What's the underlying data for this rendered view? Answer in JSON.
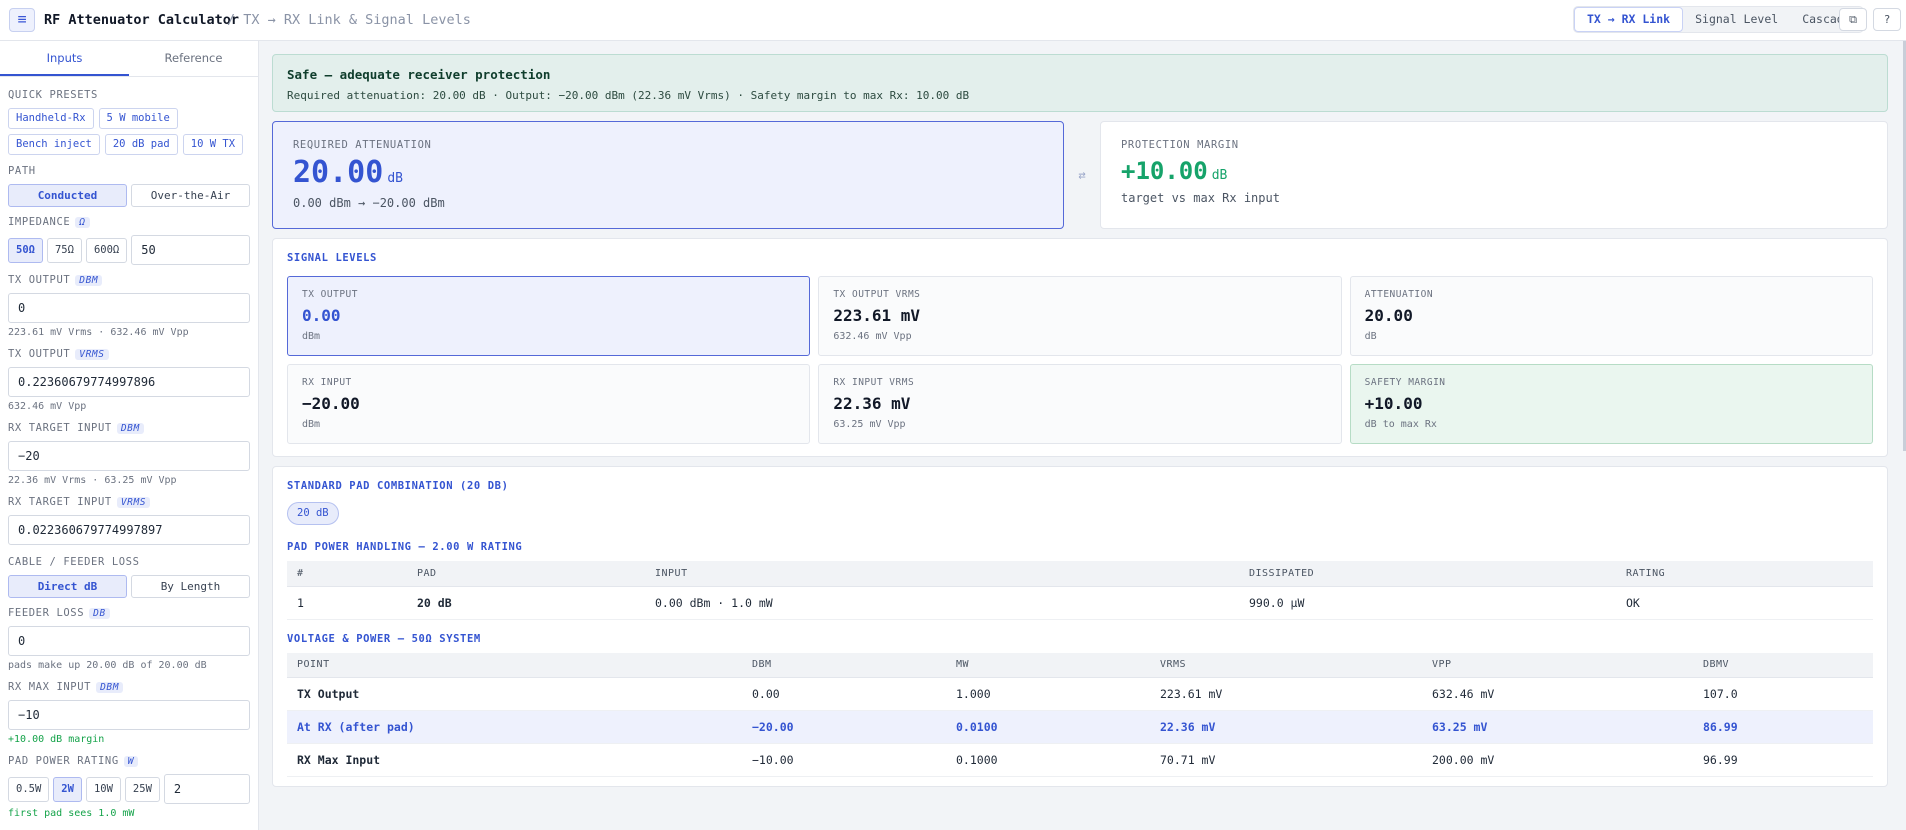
{
  "header": {
    "title": "RF Attenuator Calculator",
    "subtitle": "/ TX → RX Link & Signal Levels",
    "modes": [
      "TX → RX Link",
      "Signal Level",
      "Cascade"
    ],
    "copy_icon": "⧉",
    "help_icon": "?"
  },
  "sidebar": {
    "tabs": [
      "Inputs",
      "Reference"
    ],
    "quick_presets_label": "QUICK PRESETS",
    "presets": [
      "Handheld-Rx",
      "5 W mobile",
      "Bench inject",
      "20 dB pad",
      "10 W TX"
    ],
    "path_label": "PATH",
    "path_options": [
      "Conducted",
      "Over-the-Air"
    ],
    "impedance_label": "IMPEDANCE",
    "impedance_unit": "Ω",
    "impedance_options": [
      "50Ω",
      "75Ω",
      "600Ω"
    ],
    "impedance_value": "50",
    "tx_dbm_label": "TX OUTPUT",
    "tx_dbm_unit": "DBM",
    "tx_dbm_value": "0",
    "tx_dbm_hint": "223.61 mV Vrms · 632.46 mV Vpp",
    "tx_vrms_label": "TX OUTPUT",
    "tx_vrms_unit": "VRMS",
    "tx_vrms_value": "0.22360679774997896",
    "tx_vrms_hint": "632.46 mV Vpp",
    "rx_dbm_label": "RX TARGET INPUT",
    "rx_dbm_unit": "DBM",
    "rx_dbm_value": "−20",
    "rx_dbm_hint": "22.36 mV Vrms · 63.25 mV Vpp",
    "rx_vrms_label": "RX TARGET INPUT",
    "rx_vrms_unit": "VRMS",
    "rx_vrms_value": "0.022360679774997897",
    "cable_label": "CABLE / FEEDER LOSS",
    "cable_options": [
      "Direct dB",
      "By Length"
    ],
    "feeder_label": "FEEDER LOSS",
    "feeder_unit": "DB",
    "feeder_value": "0",
    "feeder_hint": "pads make up 20.00 dB of 20.00 dB",
    "rxmax_label": "RX MAX INPUT",
    "rxmax_unit": "DBM",
    "rxmax_value": "−10",
    "rxmax_hint": "+10.00 dB margin",
    "rating_label": "PAD POWER RATING",
    "rating_unit": "W",
    "rating_options": [
      "0.5W",
      "2W",
      "10W",
      "25W"
    ],
    "rating_value": "2",
    "rating_hint": "first pad sees 1.0 mW"
  },
  "banner": {
    "title": "Safe — adequate receiver protection",
    "detail": "Required attenuation: 20.00 dB · Output: −20.00 dBm (22.36 mV Vrms) · Safety margin to max Rx: 10.00 dB"
  },
  "hero": {
    "required_label": "REQUIRED ATTENUATION",
    "required_value": "20.00",
    "required_unit": "dB",
    "required_sub": "0.00 dBm → −20.00 dBm",
    "swap_icon": "⇄",
    "margin_label": "PROTECTION MARGIN",
    "margin_value": "+10.00",
    "margin_unit": "dB",
    "margin_sub": "target vs max Rx input"
  },
  "signal": {
    "title": "SIGNAL LEVELS",
    "cells": [
      {
        "label": "TX OUTPUT",
        "value": "0.00",
        "sub": "dBm"
      },
      {
        "label": "TX OUTPUT VRMS",
        "value": "223.61 mV",
        "sub": "632.46 mV Vpp"
      },
      {
        "label": "ATTENUATION",
        "value": "20.00",
        "sub": "dB"
      },
      {
        "label": "RX INPUT",
        "value": "−20.00",
        "sub": "dBm"
      },
      {
        "label": "RX INPUT VRMS",
        "value": "22.36 mV",
        "sub": "63.25 mV Vpp"
      },
      {
        "label": "SAFETY MARGIN",
        "value": "+10.00",
        "sub": "dB to max Rx"
      }
    ]
  },
  "pads": {
    "title": "STANDARD PAD COMBINATION (20 DB)",
    "pill": "20 dB",
    "power_title": "PAD POWER HANDLING — 2.00 W RATING",
    "headers": [
      "#",
      "PAD",
      "INPUT",
      "DISSIPATED",
      "RATING"
    ],
    "rows": [
      [
        "1",
        "20 dB",
        "0.00 dBm · 1.0 mW",
        "990.0 µW",
        "OK"
      ]
    ]
  },
  "vp": {
    "title": "VOLTAGE & POWER — 50Ω SYSTEM",
    "headers": [
      "POINT",
      "DBM",
      "MW",
      "VRMS",
      "VPP",
      "DBMV"
    ],
    "rows": [
      [
        "TX Output",
        "0.00",
        "1.000",
        "223.61 mV",
        "632.46 mV",
        "107.0"
      ],
      [
        "At RX (after pad)",
        "−20.00",
        "0.0100",
        "22.36 mV",
        "63.25 mV",
        "86.99"
      ],
      [
        "RX Max Input",
        "−10.00",
        "0.1000",
        "70.71 mV",
        "200.00 mV",
        "96.99"
      ]
    ]
  }
}
